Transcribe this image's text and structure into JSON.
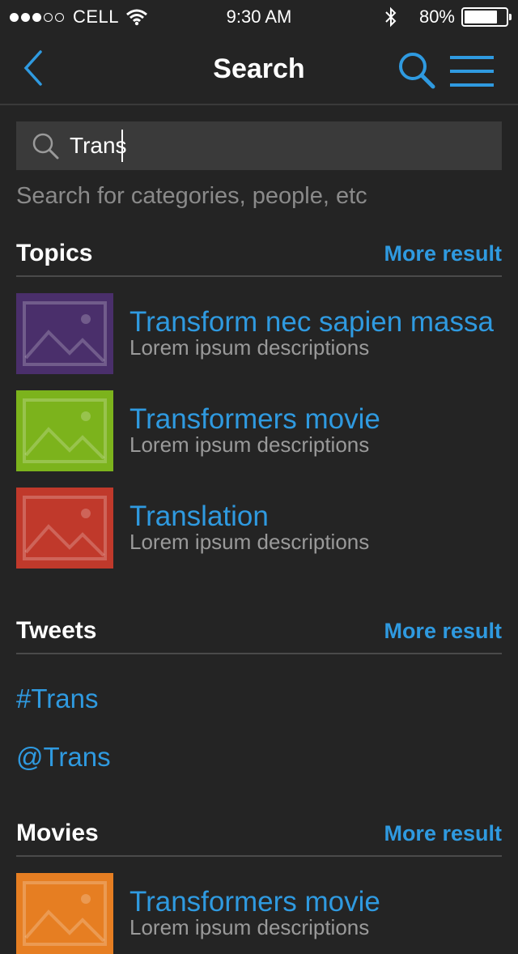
{
  "status_bar": {
    "carrier": "CELL",
    "time": "9:30 AM",
    "battery": "80%",
    "battery_level": 0.8
  },
  "nav": {
    "title": "Search",
    "back_icon": "chevron-left-icon",
    "search_icon": "search-icon",
    "menu_icon": "hamburger-menu-icon"
  },
  "search": {
    "value": "Trans",
    "hint": "Search for categories, people, etc"
  },
  "sections": {
    "topics": {
      "title": "Topics",
      "more": "More result",
      "items": [
        {
          "title": "Transform nec sapien massa",
          "desc": "Lorem ipsum descriptions",
          "color": "#4a2f6b"
        },
        {
          "title": "Transformers movie",
          "desc": "Lorem ipsum descriptions",
          "color": "#7cb31c"
        },
        {
          "title": "Translation",
          "desc": "Lorem ipsum descriptions",
          "color": "#c0392b"
        }
      ]
    },
    "tweets": {
      "title": "Tweets",
      "more": "More result",
      "items": [
        "#Trans",
        "@Trans"
      ]
    },
    "movies": {
      "title": "Movies",
      "more": "More result",
      "items": [
        {
          "title": "Transformers movie",
          "desc": "Lorem ipsum descriptions",
          "color": "#e67e22"
        }
      ]
    }
  },
  "colors": {
    "accent": "#2f9ae0",
    "background": "#242424"
  }
}
